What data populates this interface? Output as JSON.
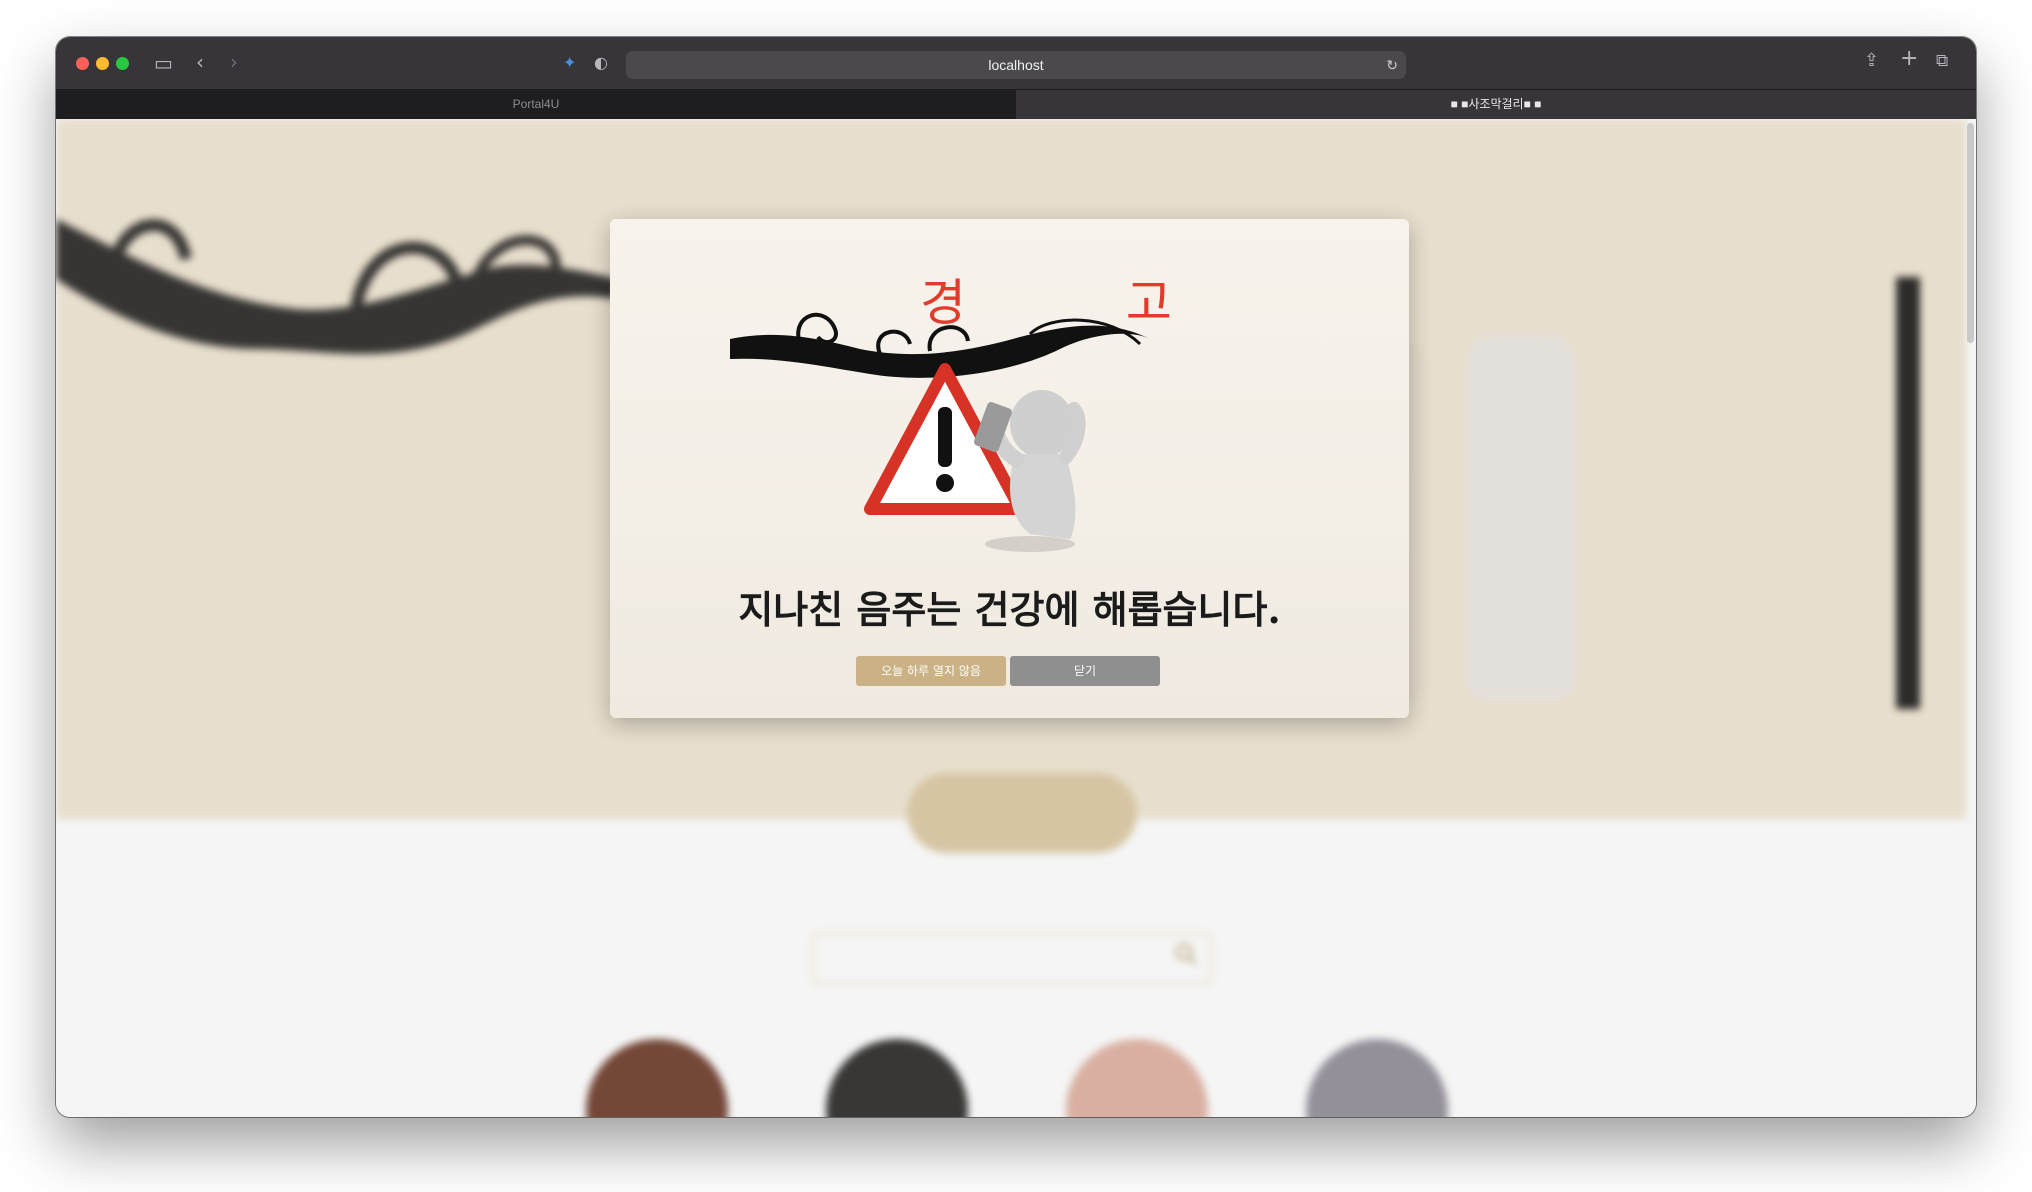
{
  "browser": {
    "url": "localhost",
    "tabs": [
      {
        "label": "Portal4U"
      },
      {
        "label": "■ ■사조막걸리■ ■"
      }
    ]
  },
  "modal": {
    "title": "경 고",
    "message": "지나친 음주는 건강에 해롭습니다.",
    "dont_show_today_label": "오늘 하루 열지 않음",
    "close_label": "닫기",
    "colors": {
      "title": "#e23a2b",
      "dont_show_button": "#cbb286",
      "close_button": "#8f8f8f"
    }
  }
}
